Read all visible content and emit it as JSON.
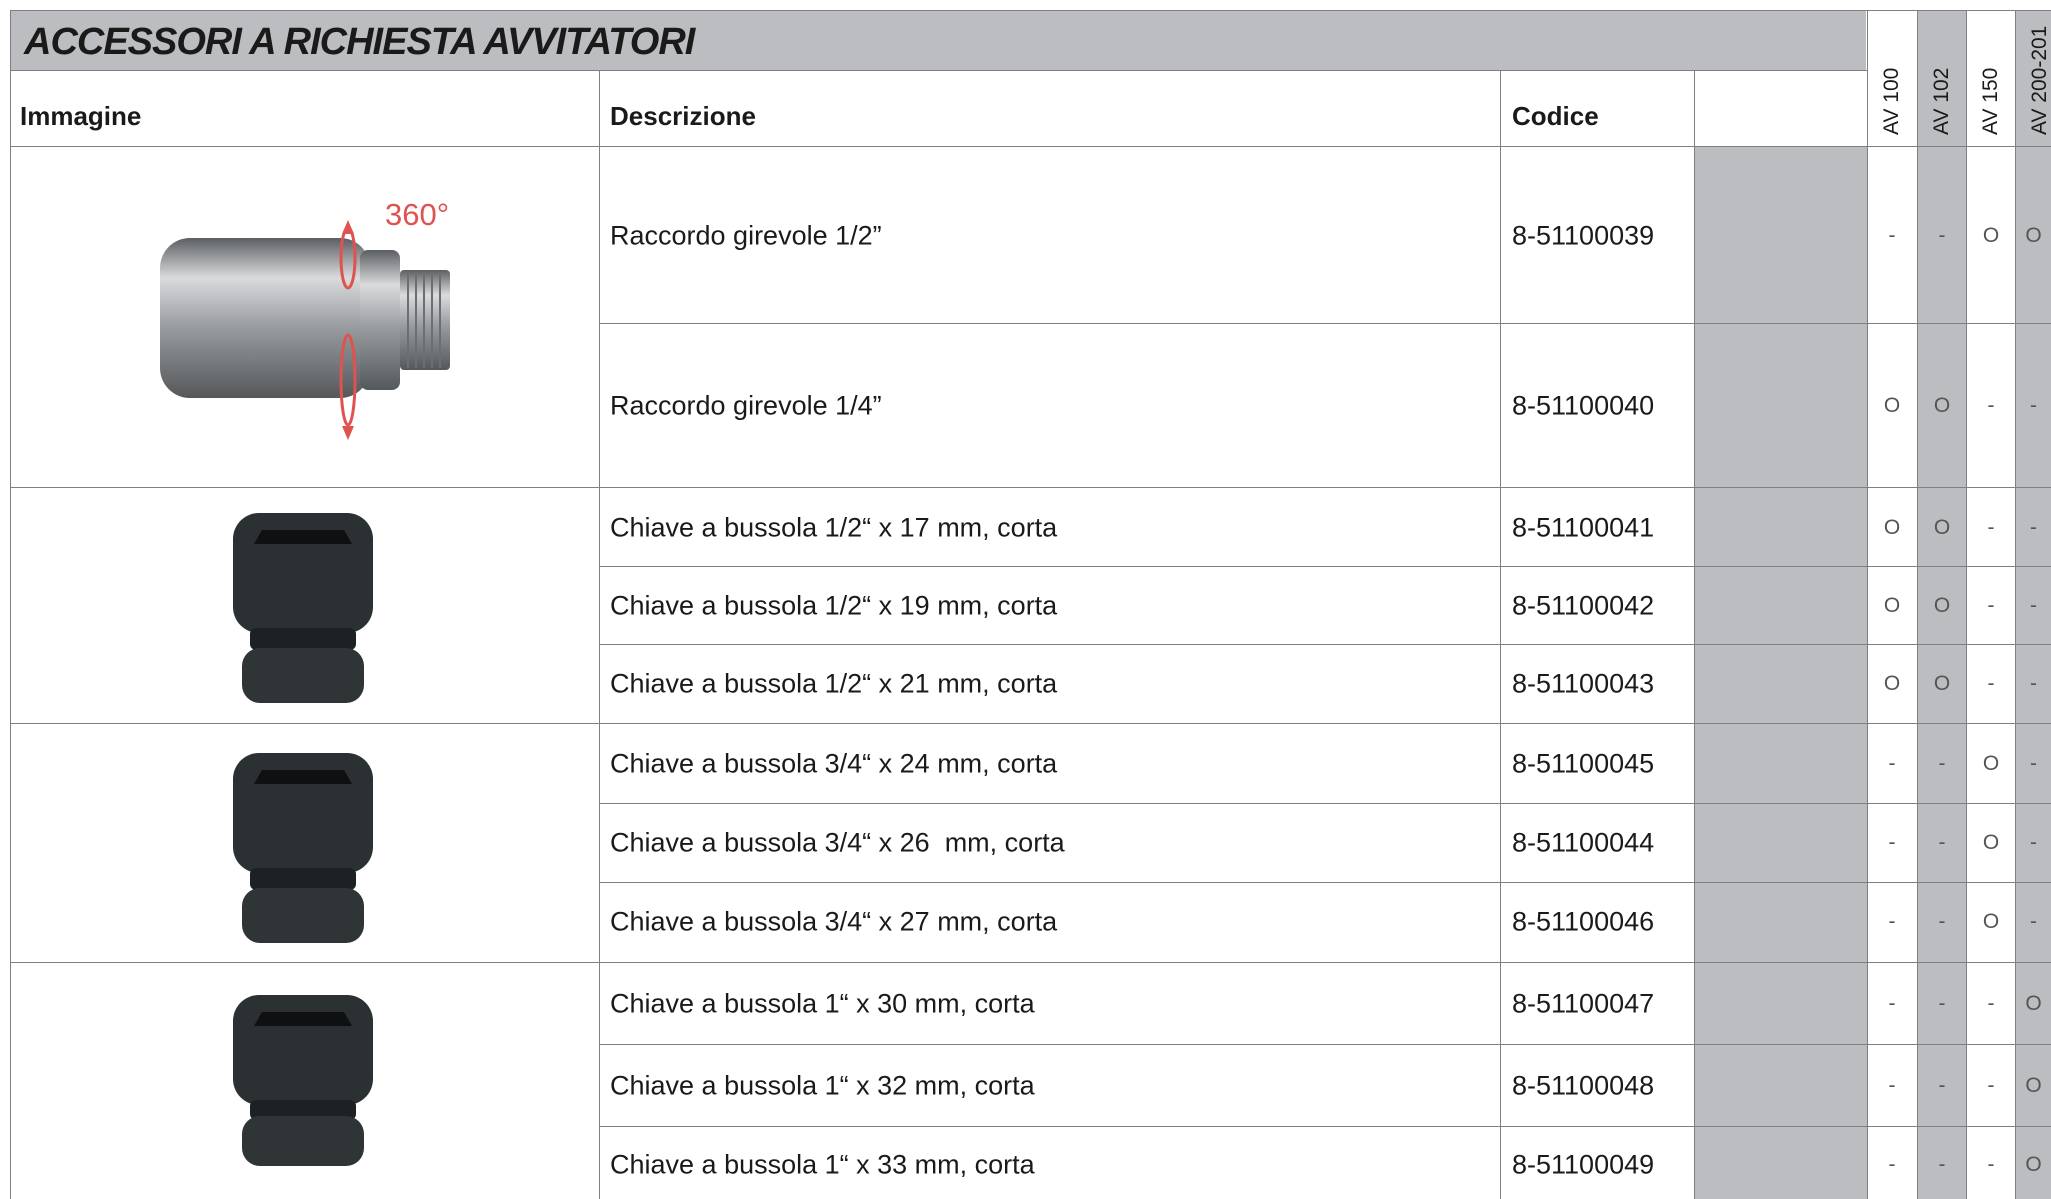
{
  "title": "ACCESSORI A RICHIESTA AVVITATORI",
  "headers": {
    "image": "Immagine",
    "description": "Descrizione",
    "code": "Codice"
  },
  "models": [
    "AV 100",
    "AV 102",
    "AV 150",
    "AV 200-201"
  ],
  "annotation": "360°",
  "rows": [
    {
      "description": "Raccordo girevole 1/2”",
      "code": "8-51100039",
      "marks": [
        "-",
        "-",
        "O",
        "O"
      ]
    },
    {
      "description": "Raccordo girevole 1/4”",
      "code": "8-51100040",
      "marks": [
        "O",
        "O",
        "-",
        "-"
      ]
    },
    {
      "description": "Chiave a bussola 1/2“ x 17 mm, corta",
      "code": "8-51100041",
      "marks": [
        "O",
        "O",
        "-",
        "-"
      ]
    },
    {
      "description": "Chiave a bussola 1/2“ x 19 mm, corta",
      "code": "8-51100042",
      "marks": [
        "O",
        "O",
        "-",
        "-"
      ]
    },
    {
      "description": "Chiave a bussola 1/2“ x 21 mm, corta",
      "code": "8-51100043",
      "marks": [
        "O",
        "O",
        "-",
        "-"
      ]
    },
    {
      "description": "Chiave a bussola 3/4“ x 24 mm, corta",
      "code": "8-51100045",
      "marks": [
        "-",
        "-",
        "O",
        "-"
      ]
    },
    {
      "description": "Chiave a bussola 3/4“ x 26  mm, corta",
      "code": "8-51100044",
      "marks": [
        "-",
        "-",
        "O",
        "-"
      ]
    },
    {
      "description": "Chiave a bussola 3/4“ x 27 mm, corta",
      "code": "8-51100046",
      "marks": [
        "-",
        "-",
        "O",
        "-"
      ]
    },
    {
      "description": "Chiave a bussola 1“ x 30 mm, corta",
      "code": "8-51100047",
      "marks": [
        "-",
        "-",
        "-",
        "O"
      ]
    },
    {
      "description": "Chiave a bussola 1“ x 32 mm, corta",
      "code": "8-51100048",
      "marks": [
        "-",
        "-",
        "-",
        "O"
      ]
    },
    {
      "description": "Chiave a bussola 1“ x 33 mm, corta",
      "code": "8-51100049",
      "marks": [
        "-",
        "-",
        "-",
        "O"
      ]
    }
  ],
  "colors": {
    "header_band": "#bcbdc0",
    "annotation_red": "#e0524f",
    "socket": "#2b3033"
  }
}
